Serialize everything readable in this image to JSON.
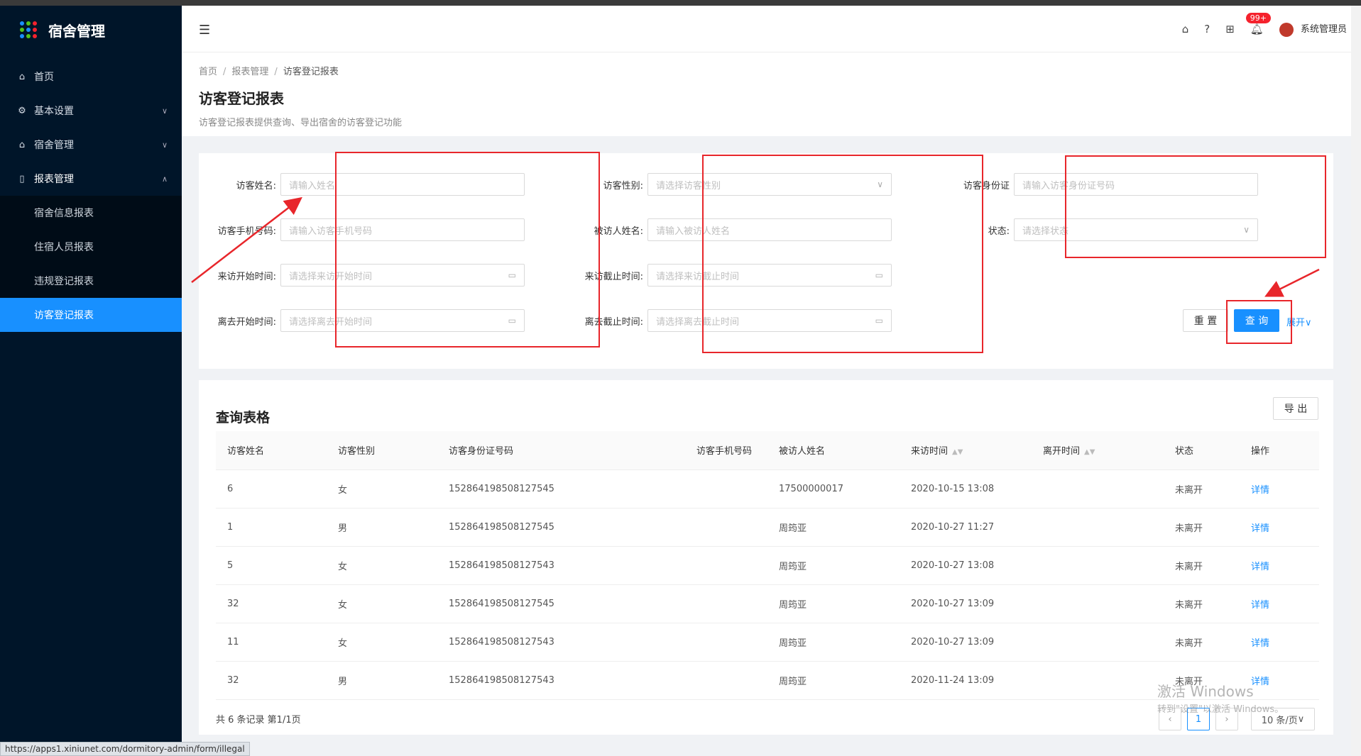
{
  "app": {
    "title": "宿舍管理"
  },
  "sidebar": {
    "items": [
      {
        "label": "首页"
      },
      {
        "label": "基本设置"
      },
      {
        "label": "宿舍管理"
      },
      {
        "label": "报表管理"
      }
    ],
    "sub_items": [
      {
        "label": "宿舍信息报表"
      },
      {
        "label": "住宿人员报表"
      },
      {
        "label": "违规登记报表"
      },
      {
        "label": "访客登记报表",
        "active": true
      }
    ]
  },
  "header": {
    "badge": "99+",
    "user": "系统管理员"
  },
  "breadcrumb": [
    "首页",
    "报表管理",
    "访客登记报表"
  ],
  "page": {
    "title": "访客登记报表",
    "description": "访客登记报表提供查询、导出宿舍的访客登记功能"
  },
  "search": {
    "fields": [
      {
        "label": "访客姓名:",
        "placeholder": "请输入姓名"
      },
      {
        "label": "访客手机号码:",
        "placeholder": "请输入访客手机号码"
      },
      {
        "label": "来访开始时间:",
        "placeholder": "请选择来访开始时间"
      },
      {
        "label": "离去开始时间:",
        "placeholder": "请选择离去开始时间"
      },
      {
        "label": "访客性别:",
        "placeholder": "请选择访客性别"
      },
      {
        "label": "被访人姓名:",
        "placeholder": "请输入被访人姓名"
      },
      {
        "label": "来访截止时间:",
        "placeholder": "请选择来访截止时间"
      },
      {
        "label": "离去截止时间:",
        "placeholder": "请选择离去截止时间"
      },
      {
        "label": "访客身份证",
        "placeholder": "请输入访客身份证号码"
      },
      {
        "label": "状态:",
        "placeholder": "请选择状态"
      }
    ],
    "reset_label": "重 置",
    "query_label": "查 询",
    "expand_label": "展开"
  },
  "table": {
    "title": "查询表格",
    "export_label": "导 出",
    "columns": [
      "访客姓名",
      "访客性别",
      "访客身份证号码",
      "访客手机号码",
      "被访人姓名",
      "来访时间",
      "离开时间",
      "状态",
      "操作"
    ],
    "rows": [
      [
        "6",
        "女",
        "152864198508127545",
        "",
        "17500000017",
        "2020-10-15 13:08",
        "",
        "未离开",
        "详情"
      ],
      [
        "1",
        "男",
        "152864198508127545",
        "",
        "周筠亚",
        "2020-10-27 11:27",
        "",
        "未离开",
        "详情"
      ],
      [
        "5",
        "女",
        "152864198508127543",
        "",
        "周筠亚",
        "2020-10-27 13:08",
        "",
        "未离开",
        "详情"
      ],
      [
        "32",
        "女",
        "152864198508127545",
        "",
        "周筠亚",
        "2020-10-27 13:09",
        "",
        "未离开",
        "详情"
      ],
      [
        "11",
        "女",
        "152864198508127543",
        "",
        "周筠亚",
        "2020-10-27 13:09",
        "",
        "未离开",
        "详情"
      ],
      [
        "32",
        "男",
        "152864198508127543",
        "",
        "周筠亚",
        "2020-11-24 13:09",
        "",
        "未离开",
        "详情"
      ]
    ],
    "total_text": "共 6 条记录 第1/1页",
    "current_page": "1",
    "page_size": "10 条/页"
  },
  "status_url": "https://apps1.xiniunet.com/dormitory-admin/form/illegal",
  "watermark": {
    "line1": "激活 Windows",
    "line2": "转到\"设置\"以激活 Windows。"
  }
}
